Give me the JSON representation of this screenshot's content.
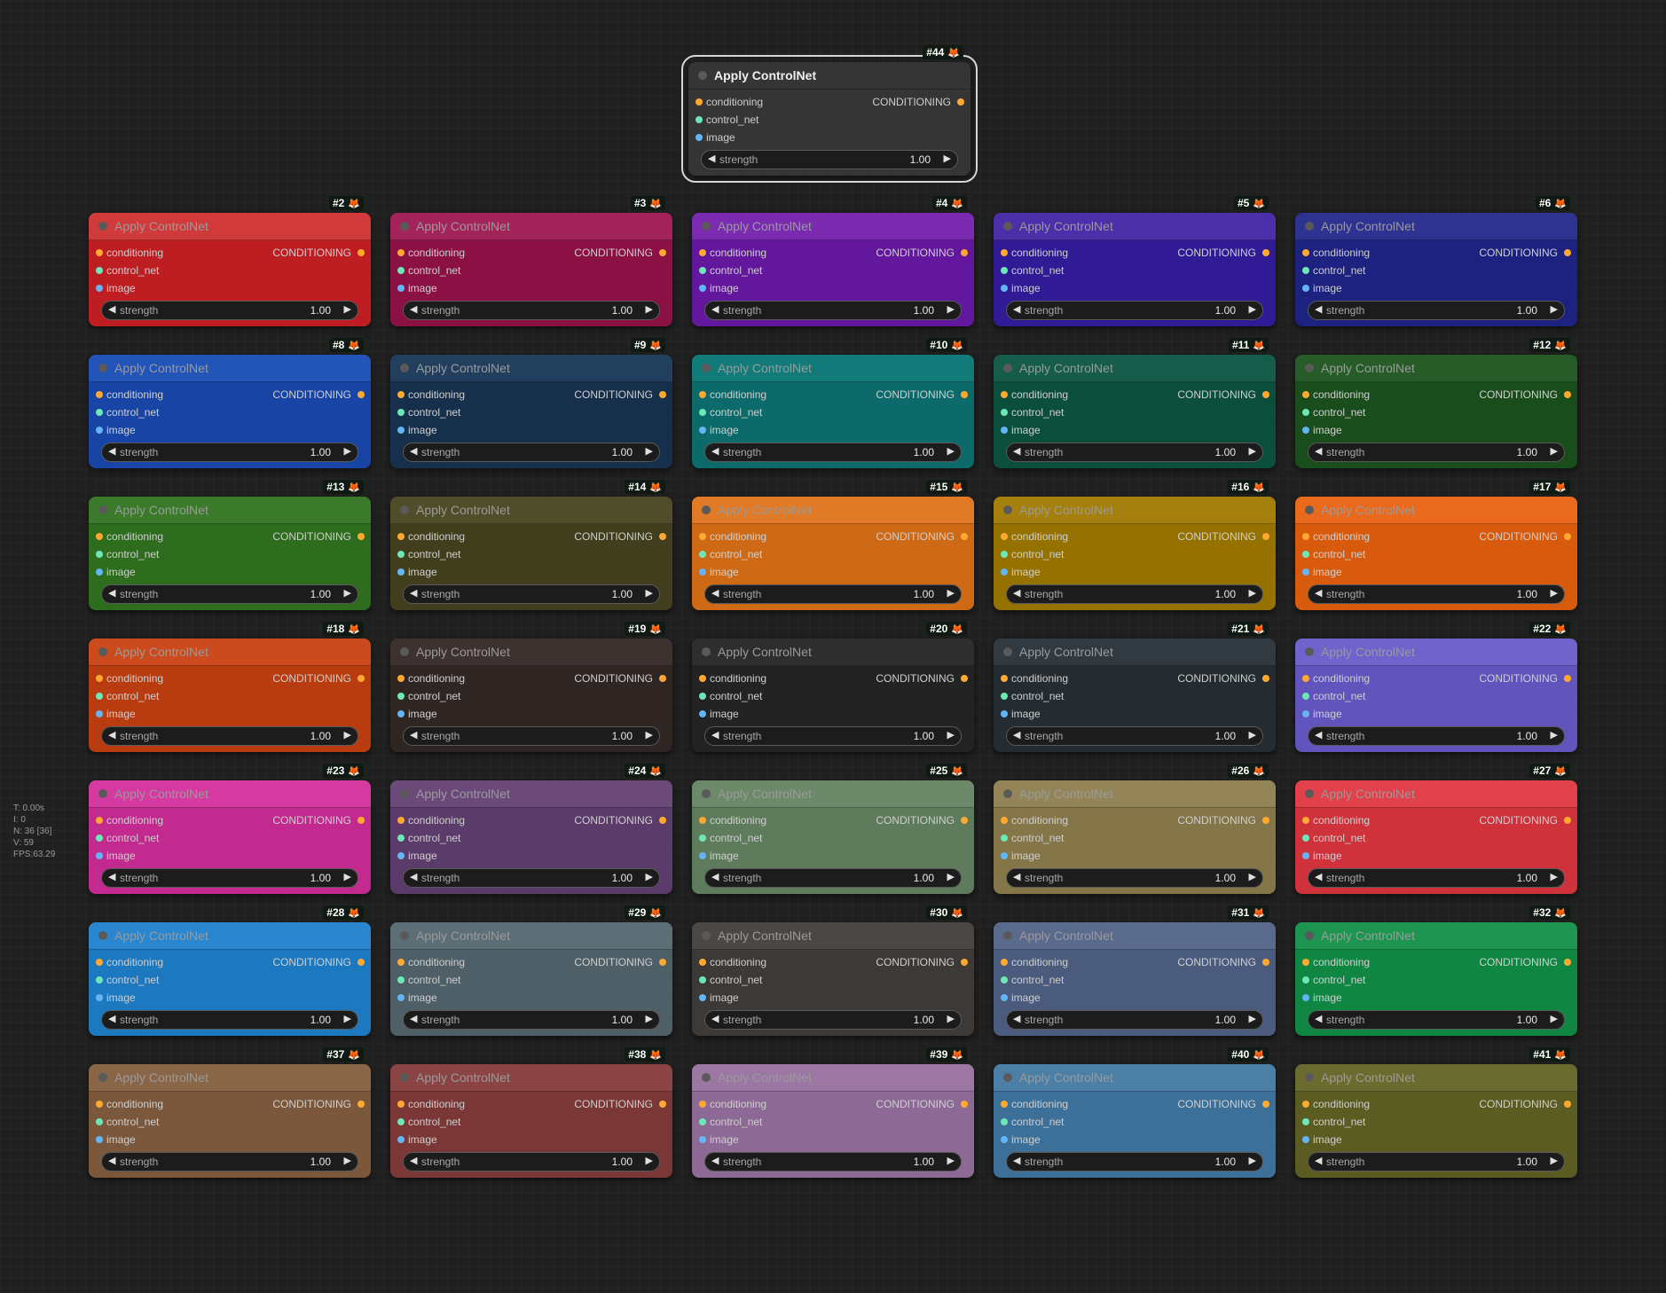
{
  "node_title": "Apply ControlNet",
  "inputs": [
    {
      "label": "conditioning",
      "color": "#ffa931"
    },
    {
      "label": "control_net",
      "color": "#6ee7b7"
    },
    {
      "label": "image",
      "color": "#64b5f6"
    }
  ],
  "output_label": "CONDITIONING",
  "widget": {
    "name": "strength",
    "value": "1.00",
    "left_arrow": "◀",
    "right_arrow": "▶"
  },
  "badge_icon": "fox-icon",
  "stats": {
    "t": "T: 0.00s",
    "i": "I: 0",
    "n": "N: 36 [36]",
    "v": "V: 59",
    "fps": "FPS:63.29"
  },
  "nodes": [
    {
      "id": "#44",
      "head": "#353535",
      "body": "#353535",
      "selected": true
    },
    {
      "id": "#2",
      "head": "#d13a3a",
      "body": "#be1e22"
    },
    {
      "id": "#3",
      "head": "#a3245a",
      "body": "#8b1145"
    },
    {
      "id": "#4",
      "head": "#7b2bb0",
      "body": "#63179d"
    },
    {
      "id": "#5",
      "head": "#4a2fa8",
      "body": "#311a96"
    },
    {
      "id": "#6",
      "head": "#2e3392",
      "body": "#1d2180"
    },
    {
      "id": "#8",
      "head": "#2354b8",
      "body": "#1845a5"
    },
    {
      "id": "#9",
      "head": "#22405e",
      "body": "#16304c"
    },
    {
      "id": "#10",
      "head": "#137a7a",
      "body": "#0c6a6a"
    },
    {
      "id": "#11",
      "head": "#155c4b",
      "body": "#0b4e3c"
    },
    {
      "id": "#12",
      "head": "#275c28",
      "body": "#1a4d1c"
    },
    {
      "id": "#13",
      "head": "#3a7a2a",
      "body": "#2e6c1e"
    },
    {
      "id": "#14",
      "head": "#4f4d2a",
      "body": "#403e1d"
    },
    {
      "id": "#15",
      "head": "#e07a26",
      "body": "#ce6a16"
    },
    {
      "id": "#16",
      "head": "#a5800f",
      "body": "#957200"
    },
    {
      "id": "#17",
      "head": "#ea6a1d",
      "body": "#d85a0d"
    },
    {
      "id": "#18",
      "head": "#cb4b1f",
      "body": "#b93b10"
    },
    {
      "id": "#19",
      "head": "#3d3230",
      "body": "#2f2624"
    },
    {
      "id": "#20",
      "head": "#2e2e2e",
      "body": "#232323"
    },
    {
      "id": "#21",
      "head": "#303a40",
      "body": "#242c31"
    },
    {
      "id": "#22",
      "head": "#7063cc",
      "body": "#6154bd"
    },
    {
      "id": "#23",
      "head": "#d43aa0",
      "body": "#c22a8f"
    },
    {
      "id": "#24",
      "head": "#6b4a7a",
      "body": "#5b3b6a"
    },
    {
      "id": "#25",
      "head": "#6c8a6a",
      "body": "#5e7c5c"
    },
    {
      "id": "#26",
      "head": "#938557",
      "body": "#847648"
    },
    {
      "id": "#27",
      "head": "#e1414a",
      "body": "#cf323b"
    },
    {
      "id": "#28",
      "head": "#2a86cf",
      "body": "#1c78bf"
    },
    {
      "id": "#29",
      "head": "#5c6e76",
      "body": "#4e5f67"
    },
    {
      "id": "#30",
      "head": "#4a4744",
      "body": "#3c3936"
    },
    {
      "id": "#31",
      "head": "#5a6a8d",
      "body": "#4b5b7e"
    },
    {
      "id": "#32",
      "head": "#1d9551",
      "body": "#0f8743"
    },
    {
      "id": "#37",
      "head": "#8a6649",
      "body": "#7b583b"
    },
    {
      "id": "#38",
      "head": "#8a4444",
      "body": "#7b3636"
    },
    {
      "id": "#39",
      "head": "#9c77a4",
      "body": "#8d6995"
    },
    {
      "id": "#40",
      "head": "#4b7fa6",
      "body": "#3d7098"
    },
    {
      "id": "#41",
      "head": "#6a6b2f",
      "body": "#5b5c21"
    }
  ]
}
